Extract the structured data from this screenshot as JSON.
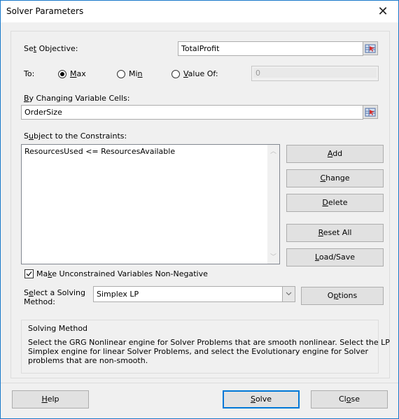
{
  "window": {
    "title": "Solver Parameters",
    "close_icon": "close-icon"
  },
  "objective": {
    "label_pre": "Se",
    "label_ul": "t",
    "label_post": " Objective:",
    "value": "TotalProfit"
  },
  "to": {
    "label": "To:",
    "options": [
      {
        "pre": "",
        "ul": "M",
        "post": "ax",
        "selected": true
      },
      {
        "pre": "Mi",
        "ul": "n",
        "post": "",
        "selected": false
      },
      {
        "pre": "",
        "ul": "V",
        "post": "alue Of:",
        "selected": false
      }
    ],
    "value_of": "0"
  },
  "changing": {
    "label_ul": "B",
    "label_post": "y Changing Variable Cells:",
    "value": "OrderSize"
  },
  "constraints": {
    "label_pre": "S",
    "label_ul": "u",
    "label_post": "bject to the Constraints:",
    "items": [
      "ResourcesUsed <= ResourcesAvailable"
    ]
  },
  "buttons": {
    "add": {
      "ul": "A",
      "post": "dd"
    },
    "change": {
      "ul": "C",
      "post": "hange"
    },
    "delete": {
      "ul": "D",
      "post": "elete"
    },
    "reset": {
      "ul": "R",
      "post": "eset All"
    },
    "loadsave": {
      "ul": "L",
      "post": "oad/Save"
    },
    "options": {
      "pre": "O",
      "ul": "p",
      "post": "tions"
    },
    "help": {
      "ul": "H",
      "post": "elp"
    },
    "solve": {
      "ul": "S",
      "post": "olve"
    },
    "close": {
      "pre": "Cl",
      "ul": "o",
      "post": "se"
    }
  },
  "nonneg": {
    "pre": "Ma",
    "ul": "k",
    "post": "e Unconstrained Variables Non-Negative",
    "checked": true
  },
  "method": {
    "label_pre": "S",
    "label_ul": "e",
    "label_post": "lect a Solving",
    "label_line2": "Method:",
    "selected": "Simplex LP"
  },
  "solving_method": {
    "title": "Solving Method",
    "line1": "Select the GRG Nonlinear engine for Solver Problems that are smooth nonlinear. Select the LP",
    "line2": "Simplex engine for linear Solver Problems, and select the Evolutionary engine for Solver",
    "line3": "problems that are non-smooth."
  }
}
